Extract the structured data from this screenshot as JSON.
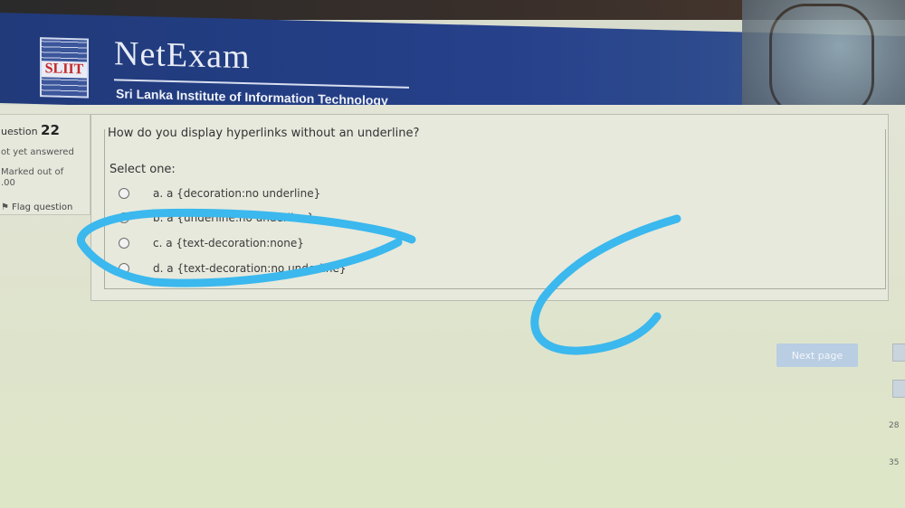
{
  "header": {
    "logo_text": "SLIIT",
    "brand": "NetExam",
    "institute": "Sri Lanka Institute of Information Technology"
  },
  "info": {
    "question_label": "uestion",
    "question_number": "22",
    "status": "ot yet answered",
    "marked": "Marked out of",
    "marked_value": ".00",
    "flag": "Flag question"
  },
  "question": {
    "text": "How do you display hyperlinks without an underline?",
    "select_one": "Select one:",
    "options": [
      {
        "label": "a. a {decoration:no underline}"
      },
      {
        "label": "b. a {underline:no underline}"
      },
      {
        "label": "c. a {text-decoration:none}"
      },
      {
        "label": "d. a {text-decoration:no underline}"
      }
    ]
  },
  "navigation": {
    "next_label": "Next page",
    "nav_numbers": [
      "28",
      "35"
    ]
  },
  "colors": {
    "header": "#26408a",
    "scribble": "#3bb8ee",
    "next_button": "#b9cde3"
  },
  "icons": {
    "flag": "flag-icon",
    "radio": "radio-icon"
  }
}
